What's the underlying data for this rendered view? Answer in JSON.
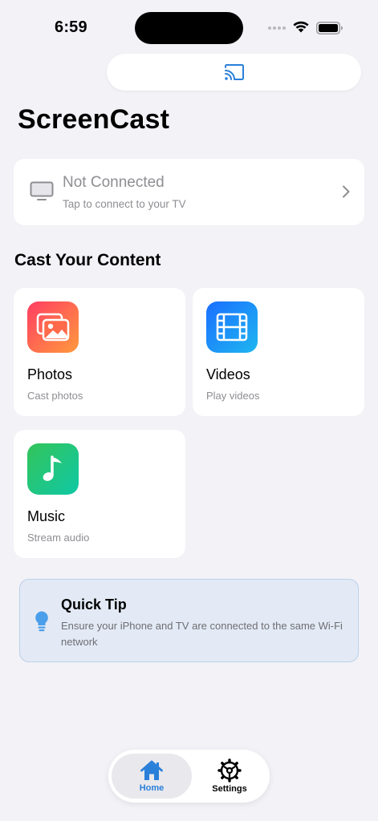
{
  "status_bar": {
    "time": "6:59"
  },
  "app": {
    "title": "ScreenCast"
  },
  "connection": {
    "title": "Not Connected",
    "subtitle": "Tap to connect to your TV"
  },
  "section": {
    "title": "Cast Your Content"
  },
  "tiles": [
    {
      "name": "Photos",
      "subtitle": "Cast photos",
      "icon": "photos-icon"
    },
    {
      "name": "Videos",
      "subtitle": "Play videos",
      "icon": "film-icon"
    },
    {
      "name": "Music",
      "subtitle": "Stream audio",
      "icon": "music-note-icon"
    }
  ],
  "tip": {
    "title": "Quick Tip",
    "text": "Ensure your iPhone and TV are connected to the same Wi-Fi network"
  },
  "tab_bar": {
    "home_label": "Home",
    "settings_label": "Settings"
  },
  "colors": {
    "accent": "#2a7fd9",
    "background": "#f2f2f7",
    "photos_gradient": [
      "#ff4a5a",
      "#ff9a3c"
    ],
    "videos_gradient": [
      "#1a78ff",
      "#1fb6f0"
    ],
    "music_gradient": [
      "#2ec36a",
      "#12c7a0"
    ]
  }
}
